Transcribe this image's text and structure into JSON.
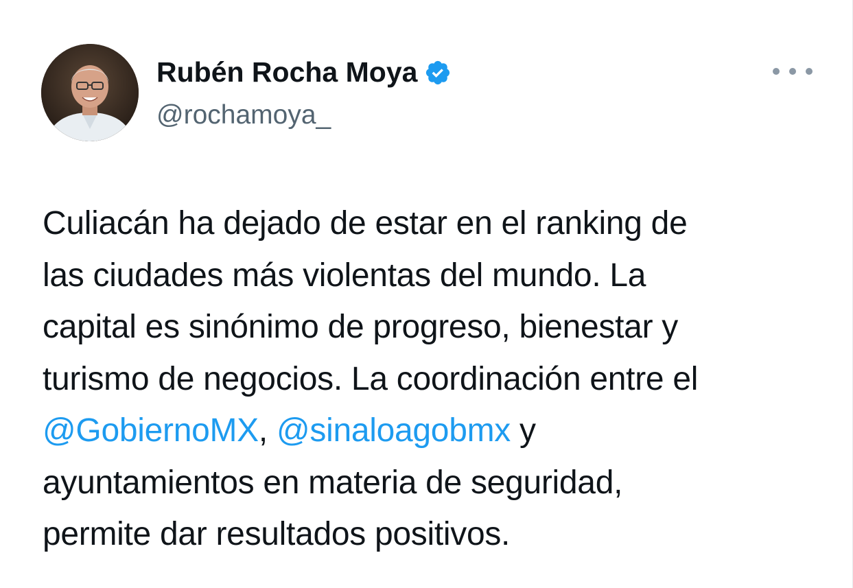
{
  "author": {
    "display_name": "Rubén Rocha Moya",
    "handle": "@rochamoya_",
    "verified_icon": "verified-badge-icon"
  },
  "menu": {
    "icon": "more-options-icon"
  },
  "tweet": {
    "lines": [
      "Culiacán ha dejado de estar en el ranking de",
      "las ciudades más violentas del mundo. La",
      "capital es sinónimo de progreso, bienestar y",
      "turismo de negocios. La coordinación entre el"
    ],
    "mention_1": "@GobiernoMX",
    "separator": ", ",
    "mention_2": "@sinaloagobmx",
    "after_mentions": " y",
    "lines_end": [
      "ayuntamientos en materia de seguridad,",
      "permite dar resultados positivos."
    ]
  },
  "colors": {
    "mention": "#1d9bf0",
    "verified": "#1d9bf0",
    "handle": "#536471",
    "text": "#0f1419"
  }
}
